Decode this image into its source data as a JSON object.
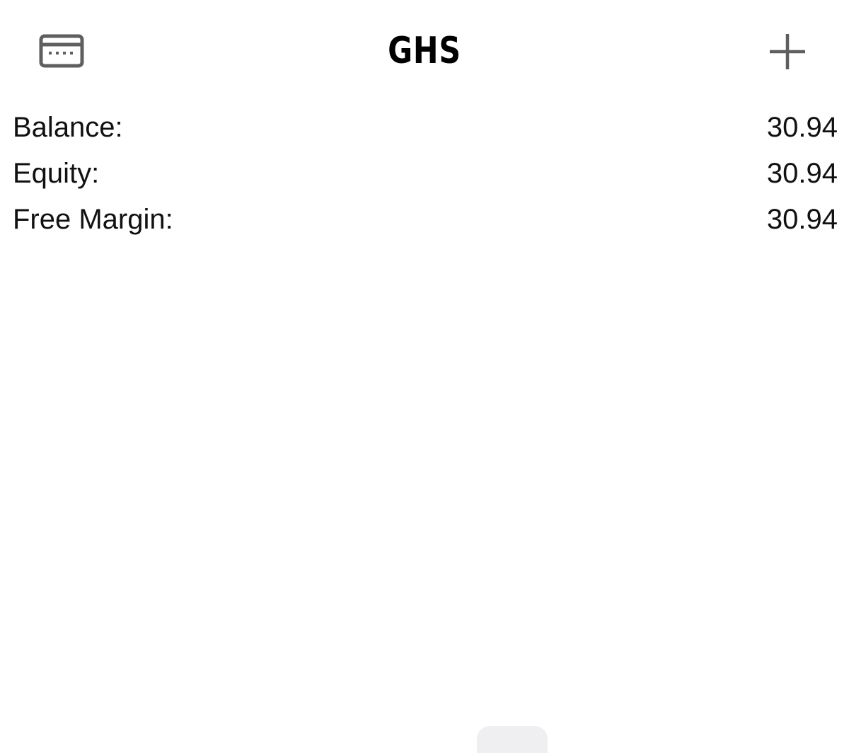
{
  "header": {
    "title": "GHS",
    "left_icon": "credit-card-icon",
    "right_icon": "plus-icon",
    "icon_color": "#5f5f5f"
  },
  "summary": {
    "rows": [
      {
        "label": "Balance:",
        "value": "30.94"
      },
      {
        "label": "Equity:",
        "value": "30.94"
      },
      {
        "label": "Free Margin:",
        "value": "30.94"
      }
    ]
  }
}
